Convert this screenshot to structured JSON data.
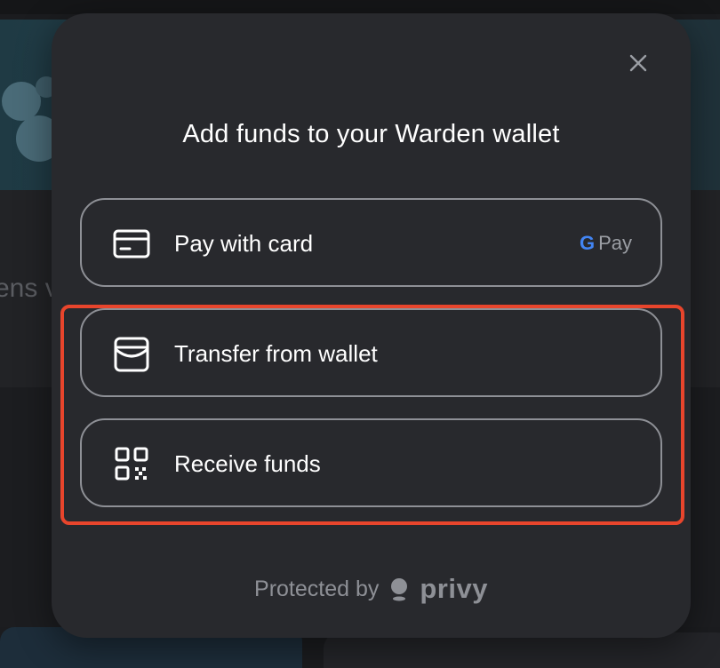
{
  "background": {
    "partial_text": "ens v"
  },
  "modal": {
    "title": "Add funds to your Warden wallet",
    "options": [
      {
        "label": "Pay with card",
        "icon": "credit-card-icon",
        "badge": "Pay"
      },
      {
        "label": "Transfer from wallet",
        "icon": "wallet-icon"
      },
      {
        "label": "Receive funds",
        "icon": "qr-code-icon"
      }
    ],
    "footer": {
      "protected_by": "Protected by",
      "brand": "privy"
    }
  },
  "colors": {
    "modal_bg": "#28292d",
    "highlight": "#e8452c",
    "border": "#8e9096"
  }
}
